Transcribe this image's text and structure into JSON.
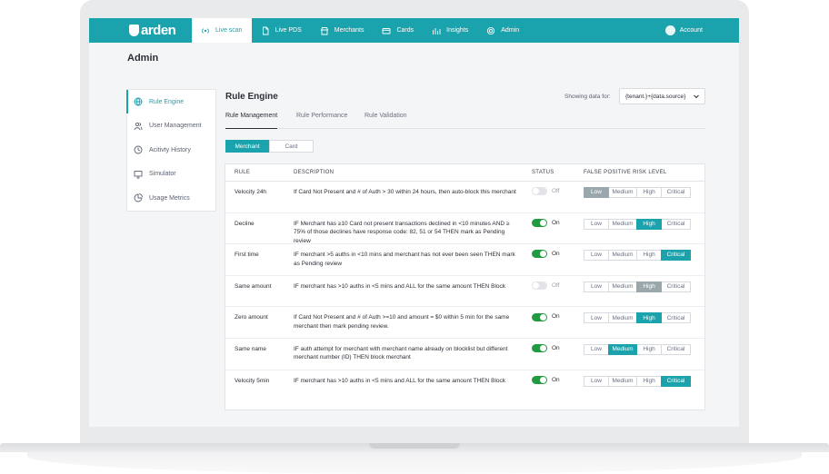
{
  "brand": {
    "name": "arden",
    "accent": "#1ba3ad",
    "on_color": "#1e9c3f"
  },
  "nav": {
    "items": [
      {
        "label": "Live scan",
        "icon": "broadcast-icon",
        "active": true
      },
      {
        "label": "Live PDS",
        "icon": "document-icon",
        "active": false
      },
      {
        "label": "Merchants",
        "icon": "store-icon",
        "active": false
      },
      {
        "label": "Cards",
        "icon": "card-icon",
        "active": false
      },
      {
        "label": "Insights",
        "icon": "bar-chart-icon",
        "active": false
      },
      {
        "label": "Admin",
        "icon": "gear-icon",
        "active": false
      }
    ],
    "account_label": "Account"
  },
  "page": {
    "title": "Admin"
  },
  "sidebar": {
    "items": [
      {
        "label": "Rule Engine",
        "icon": "globe-icon",
        "active": true
      },
      {
        "label": "User Management",
        "icon": "users-icon",
        "active": false
      },
      {
        "label": "Acitivty History",
        "icon": "clock-icon",
        "active": false
      },
      {
        "label": "Simulator",
        "icon": "monitor-icon",
        "active": false
      },
      {
        "label": "Usage Metrics",
        "icon": "pie-chart-icon",
        "active": false
      }
    ]
  },
  "content": {
    "title": "Rule Engine",
    "showing_label": "Showing data for:",
    "source_value": "{tenant.}+{data.source}",
    "tabs": [
      "Rule Management",
      "Rule Performance",
      "Rule Validation"
    ],
    "segments": [
      "Merchant",
      "Card"
    ]
  },
  "table": {
    "headers": [
      "RULE",
      "DESCRIPTION",
      "STATUS",
      "FALSE POSITIVE RISK LEVEL"
    ],
    "risk_labels": [
      "Low",
      "Medium",
      "High",
      "Critical"
    ],
    "rows": [
      {
        "rule": "Velocity 24h",
        "description": "If Card Not Present and # of Auth > 30 within 24 hours, then auto-block this merchant",
        "status": "Off",
        "risk": "Low",
        "risk_muted": true
      },
      {
        "rule": "Decline",
        "description": "IF Merchant has ≥10 Card not present transactions declined in <10 minutes AND ≥ 75% of those declines have response code: 82, 51 or 54 THEN mark as Pending review",
        "status": "On",
        "risk": "High",
        "risk_muted": false
      },
      {
        "rule": "First time",
        "description": "IF merchant >5 auths in <10 mins and merchant has not ever been seen THEN mark as Pending review",
        "status": "On",
        "risk": "Critical",
        "risk_muted": false
      },
      {
        "rule": "Same amount",
        "description": "IF merchant has >10 auths in <5 mins and ALL for the same amount THEN Block",
        "status": "Off",
        "risk": "High",
        "risk_muted": true
      },
      {
        "rule": "Zero amount",
        "description": "If Card Not Present and # of Auth >=10 and amount = $0 within 5 min for the same merchant then mark pending review.",
        "status": "On",
        "risk": "High",
        "risk_muted": false
      },
      {
        "rule": "Same name",
        "description": "IF auth attempt for merchant with merchant name already on blocklist but different merchant number (ID) THEN block merchant",
        "status": "On",
        "risk": "Medium",
        "risk_muted": false
      },
      {
        "rule": "Velocity 5min",
        "description": "IF merchant has >10 auths in <5 mins and ALL for the same amount THEN Block",
        "status": "On",
        "risk": "Critical",
        "risk_muted": false
      }
    ]
  }
}
